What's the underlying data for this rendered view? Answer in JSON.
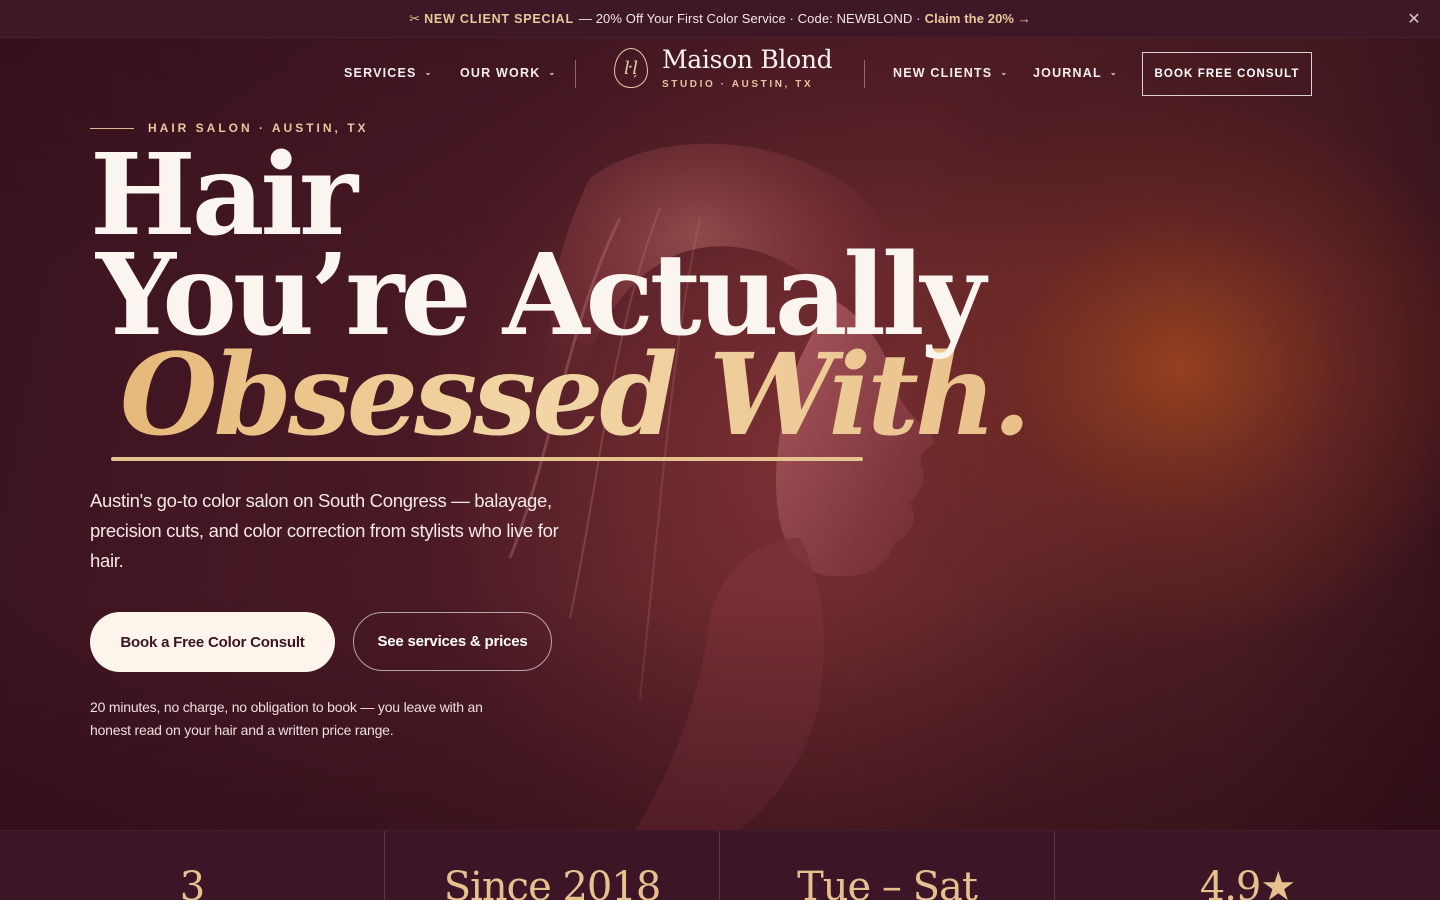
{
  "announcement": {
    "special": "NEW CLIENT SPECIAL",
    "text": "— 20% Off Your First Color Service · Code: NEWBLOND ·",
    "claim": "Claim the 20% →",
    "icon": "scissors-icon",
    "close_icon": "close-icon"
  },
  "nav": {
    "left": [
      {
        "label": "SERVICES"
      },
      {
        "label": "OUR WORK"
      }
    ],
    "right": [
      {
        "label": "NEW CLIENTS"
      },
      {
        "label": "JOURNAL"
      }
    ],
    "logo": {
      "name": "Maison Blond",
      "sub": "STUDIO · AUSTIN, TX"
    },
    "cta": "BOOK FREE CONSULT"
  },
  "hero": {
    "eyebrow": "HAIR SALON · AUSTIN, TX",
    "headline": {
      "line1": "Hair",
      "line2": "You’re Actually",
      "line3": "Obsessed With."
    },
    "lede": "Austin's go-to color salon on South Congress — balayage, precision cuts, and color correction from stylists who live for hair.",
    "cta_primary": "Book a Free Color Consult",
    "cta_secondary": "See services & prices",
    "note": "20 minutes, no charge, no obligation to book — you leave with an honest read on your hair and a written price range."
  },
  "stats": [
    {
      "value": "3"
    },
    {
      "value": "Since 2018"
    },
    {
      "value": "Tue – Sat"
    },
    {
      "value": "4.9★"
    }
  ],
  "colors": {
    "background": "#3a1420",
    "accent_gold": "#e7c08f",
    "cta_light": "#fdf4ec"
  }
}
